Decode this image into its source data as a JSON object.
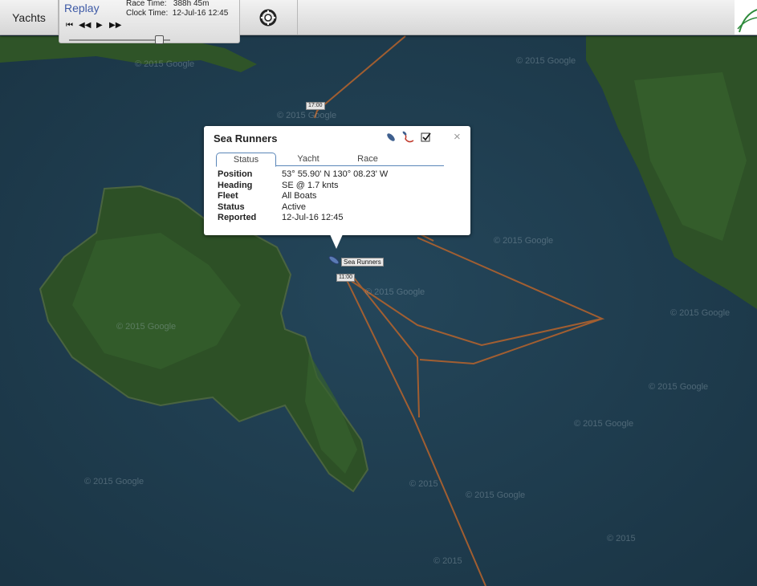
{
  "toolbar": {
    "yachts_label": "Yachts",
    "replay_title": "Replay",
    "race_time_label": "Race Time:",
    "race_time_value": "388h 45m",
    "clock_time_label": "Clock Time:",
    "clock_time_value": "12-Jul-16 12:45",
    "controls": {
      "skip_start": "⏮",
      "rewind": "◀◀",
      "play": "▶",
      "fast_forward": "▶▶"
    }
  },
  "map": {
    "watermarks": [
      "© 2015 Google",
      "© 2015 Google",
      "© 2015 Google",
      "© 2015 Google",
      "© 2015 Google",
      "© 2015 Google",
      "© 2015 Google",
      "© 2015 Google",
      "© 2015 Google",
      "© 2015 Google",
      "© 2015 Google",
      "© 2015",
      "© 2015",
      "© 2015"
    ],
    "time_markers": [
      "17:00",
      "11:00"
    ],
    "boat_label": "Sea Runners",
    "route_color": "#b8642c",
    "water_color": "#1f3d4e",
    "land_color": "#2c4d24"
  },
  "popup": {
    "title": "Sea Runners",
    "close": "×",
    "icons": [
      "boat-icon",
      "track-icon",
      "checkbox-icon"
    ],
    "tabs": [
      "Status",
      "Yacht",
      "Race"
    ],
    "fields": [
      {
        "label": "Position",
        "value": "53° 55.90' N 130° 08.23' W"
      },
      {
        "label": "Heading",
        "value": "SE @ 1.7 knts"
      },
      {
        "label": "Fleet",
        "value": "All Boats"
      },
      {
        "label": "Status",
        "value": "Active"
      },
      {
        "label": "Reported",
        "value": "12-Jul-16 12:45"
      }
    ]
  }
}
